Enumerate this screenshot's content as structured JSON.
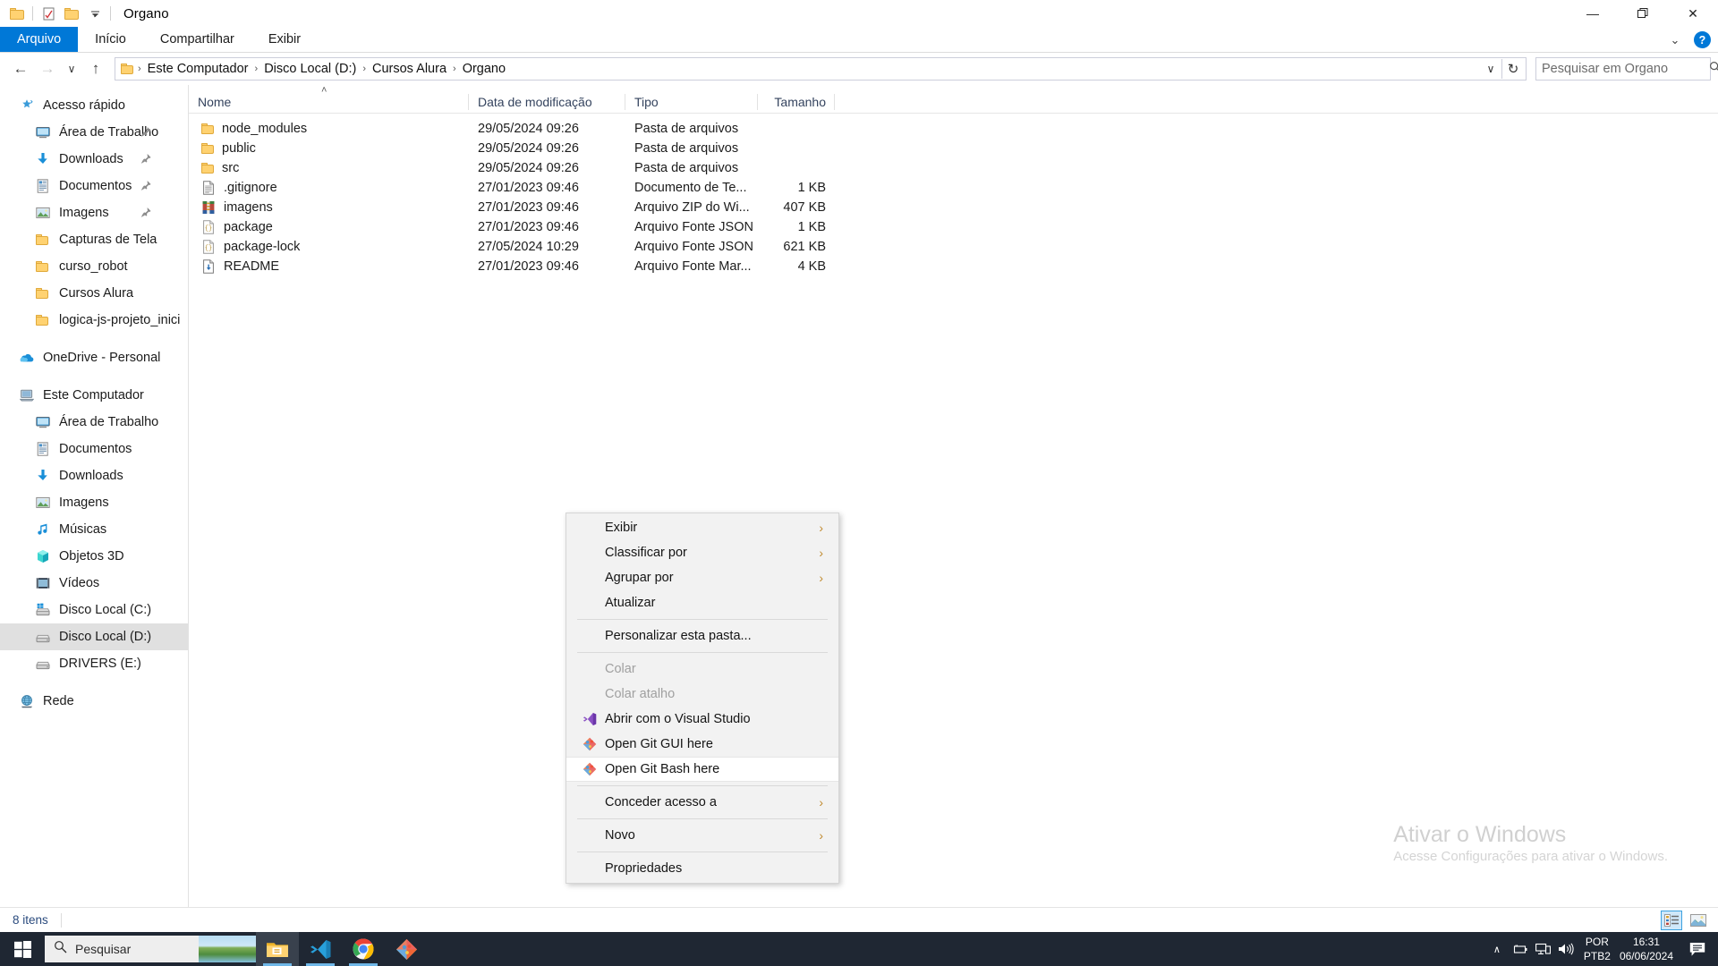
{
  "window": {
    "title": "Organo",
    "quick_access": [
      "folder-icon",
      "properties-icon",
      "new-folder-icon",
      "customize-dropdown-icon"
    ],
    "minimize": "—",
    "maximize": "❐",
    "close": "✕",
    "ribbon_collapse": "⌄",
    "help": "?"
  },
  "ribbon": {
    "tabs": [
      {
        "label": "Arquivo",
        "active": true
      },
      {
        "label": "Início",
        "active": false
      },
      {
        "label": "Compartilhar",
        "active": false
      },
      {
        "label": "Exibir",
        "active": false
      }
    ]
  },
  "nav": {
    "back": "←",
    "forward": "→",
    "recent": "∨",
    "up": "↑",
    "breadcrumbs": [
      "Este Computador",
      "Disco Local (D:)",
      "Cursos Alura",
      "Organo"
    ],
    "separator": "›",
    "dropdown": "∨",
    "refresh": "↻",
    "refresh_title": "Atualizar"
  },
  "search": {
    "placeholder": "Pesquisar em Organo",
    "value": "",
    "icon": "search-icon"
  },
  "sidebar": {
    "items": [
      {
        "label": "Acesso rápido",
        "icon": "star-icon",
        "level": 0,
        "pinned": false,
        "selected": false
      },
      {
        "label": "Área de Trabalho",
        "icon": "desktop-icon",
        "level": 1,
        "pinned": true,
        "selected": false
      },
      {
        "label": "Downloads",
        "icon": "download-icon",
        "level": 1,
        "pinned": true,
        "selected": false
      },
      {
        "label": "Documentos",
        "icon": "document-icon",
        "level": 1,
        "pinned": true,
        "selected": false
      },
      {
        "label": "Imagens",
        "icon": "pictures-icon",
        "level": 1,
        "pinned": true,
        "selected": false
      },
      {
        "label": "Capturas de Tela",
        "icon": "folder-icon",
        "level": 1,
        "pinned": false,
        "selected": false
      },
      {
        "label": "curso_robot",
        "icon": "folder-icon",
        "level": 1,
        "pinned": false,
        "selected": false
      },
      {
        "label": "Cursos Alura",
        "icon": "folder-icon",
        "level": 1,
        "pinned": false,
        "selected": false
      },
      {
        "label": "logica-js-projeto_inici",
        "icon": "folder-icon",
        "level": 1,
        "pinned": false,
        "selected": false
      },
      {
        "gap": true
      },
      {
        "label": "OneDrive - Personal",
        "icon": "onedrive-icon",
        "level": 0,
        "pinned": false,
        "selected": false
      },
      {
        "gap": true
      },
      {
        "label": "Este Computador",
        "icon": "computer-icon",
        "level": 0,
        "pinned": false,
        "selected": false
      },
      {
        "label": "Área de Trabalho",
        "icon": "desktop-icon",
        "level": 1,
        "pinned": false,
        "selected": false
      },
      {
        "label": "Documentos",
        "icon": "document-icon",
        "level": 1,
        "pinned": false,
        "selected": false
      },
      {
        "label": "Downloads",
        "icon": "download-icon",
        "level": 1,
        "pinned": false,
        "selected": false
      },
      {
        "label": "Imagens",
        "icon": "pictures-icon",
        "level": 1,
        "pinned": false,
        "selected": false
      },
      {
        "label": "Músicas",
        "icon": "music-icon",
        "level": 1,
        "pinned": false,
        "selected": false
      },
      {
        "label": "Objetos 3D",
        "icon": "cube-icon",
        "level": 1,
        "pinned": false,
        "selected": false
      },
      {
        "label": "Vídeos",
        "icon": "video-icon",
        "level": 1,
        "pinned": false,
        "selected": false
      },
      {
        "label": "Disco Local (C:)",
        "icon": "windows-drive-icon",
        "level": 1,
        "pinned": false,
        "selected": false
      },
      {
        "label": "Disco Local (D:)",
        "icon": "drive-icon",
        "level": 1,
        "pinned": false,
        "selected": true
      },
      {
        "label": "DRIVERS (E:)",
        "icon": "drive-icon",
        "level": 1,
        "pinned": false,
        "selected": false
      },
      {
        "gap": true
      },
      {
        "label": "Rede",
        "icon": "network-icon",
        "level": 0,
        "pinned": false,
        "selected": false
      }
    ]
  },
  "filelist": {
    "columns": [
      {
        "label": "Nome",
        "sorted": "asc"
      },
      {
        "label": "Data de modificação",
        "sorted": ""
      },
      {
        "label": "Tipo",
        "sorted": ""
      },
      {
        "label": "Tamanho",
        "sorted": ""
      }
    ],
    "sort_caret": "˄",
    "rows": [
      {
        "name": "node_modules",
        "date": "29/05/2024 09:26",
        "type": "Pasta de arquivos",
        "size": "",
        "icon": "folder-icon"
      },
      {
        "name": "public",
        "date": "29/05/2024 09:26",
        "type": "Pasta de arquivos",
        "size": "",
        "icon": "folder-icon"
      },
      {
        "name": "src",
        "date": "29/05/2024 09:26",
        "type": "Pasta de arquivos",
        "size": "",
        "icon": "folder-icon"
      },
      {
        "name": ".gitignore",
        "date": "27/01/2023 09:46",
        "type": "Documento de Te...",
        "size": "1 KB",
        "icon": "text-file-icon"
      },
      {
        "name": "imagens",
        "date": "27/01/2023 09:46",
        "type": "Arquivo ZIP do Wi...",
        "size": "407 KB",
        "icon": "zip-file-icon"
      },
      {
        "name": "package",
        "date": "27/01/2023 09:46",
        "type": "Arquivo Fonte JSON",
        "size": "1 KB",
        "icon": "json-file-icon"
      },
      {
        "name": "package-lock",
        "date": "27/05/2024 10:29",
        "type": "Arquivo Fonte JSON",
        "size": "621 KB",
        "icon": "json-file-icon"
      },
      {
        "name": "README",
        "date": "27/01/2023 09:46",
        "type": "Arquivo Fonte Mar...",
        "size": "4 KB",
        "icon": "markdown-file-icon"
      }
    ]
  },
  "context_menu": {
    "items": [
      {
        "label": "Exibir",
        "submenu": true,
        "icon": "",
        "disabled": false,
        "hover": false
      },
      {
        "label": "Classificar por",
        "submenu": true,
        "icon": "",
        "disabled": false,
        "hover": false
      },
      {
        "label": "Agrupar por",
        "submenu": true,
        "icon": "",
        "disabled": false,
        "hover": false
      },
      {
        "label": "Atualizar",
        "submenu": false,
        "icon": "",
        "disabled": false,
        "hover": false
      },
      {
        "separator": true
      },
      {
        "label": "Personalizar esta pasta...",
        "submenu": false,
        "icon": "",
        "disabled": false,
        "hover": false
      },
      {
        "separator": true
      },
      {
        "label": "Colar",
        "submenu": false,
        "icon": "",
        "disabled": true,
        "hover": false
      },
      {
        "label": "Colar atalho",
        "submenu": false,
        "icon": "",
        "disabled": true,
        "hover": false
      },
      {
        "label": "Abrir com o Visual Studio",
        "submenu": false,
        "icon": "visual-studio-icon",
        "disabled": false,
        "hover": false
      },
      {
        "label": "Open Git GUI here",
        "submenu": false,
        "icon": "git-icon",
        "disabled": false,
        "hover": false
      },
      {
        "label": "Open Git Bash here",
        "submenu": false,
        "icon": "git-icon",
        "disabled": false,
        "hover": true
      },
      {
        "separator": true
      },
      {
        "label": "Conceder acesso a",
        "submenu": true,
        "icon": "",
        "disabled": false,
        "hover": false
      },
      {
        "separator": true
      },
      {
        "label": "Novo",
        "submenu": true,
        "icon": "",
        "disabled": false,
        "hover": false
      },
      {
        "separator": true
      },
      {
        "label": "Propriedades",
        "submenu": false,
        "icon": "",
        "disabled": false,
        "hover": false
      }
    ],
    "arrow": "›"
  },
  "status_bar": {
    "item_count": "8 itens",
    "views": [
      {
        "name": "details-view",
        "selected": true
      },
      {
        "name": "large-icons-view",
        "selected": false
      }
    ]
  },
  "watermark": {
    "line1": "Ativar o Windows",
    "line2": "Acesse Configurações para ativar o Windows."
  },
  "taskbar": {
    "start": "windows-logo-icon",
    "search_placeholder": "Pesquisar",
    "apps": [
      {
        "name": "file-explorer",
        "active": true,
        "running": true
      },
      {
        "name": "visual-studio-code",
        "active": false,
        "running": true
      },
      {
        "name": "google-chrome",
        "active": false,
        "running": true
      },
      {
        "name": "git-bash",
        "active": false,
        "running": false
      }
    ],
    "tray": {
      "show_hidden": "∧",
      "icons": [
        "battery-icon",
        "network-icon",
        "volume-icon"
      ],
      "language_top": "POR",
      "language_bottom": "PTB2",
      "time": "16:31",
      "date": "06/06/2024",
      "action_center": "notification-icon"
    }
  },
  "colors": {
    "accent": "#0078d7",
    "taskbar": "#1f2733",
    "selection": "#e0e0e0",
    "folder": "#ffd271",
    "submenu_arrow": "#c08a2e"
  }
}
